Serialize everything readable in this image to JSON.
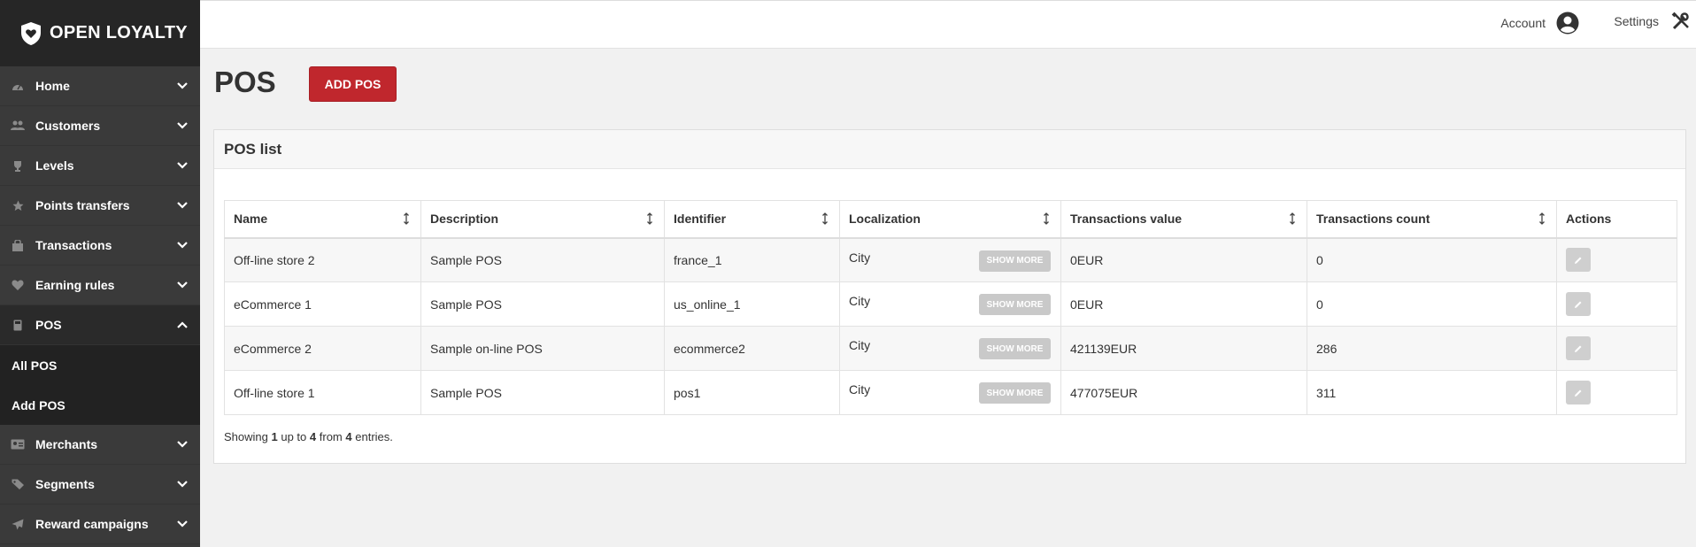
{
  "brand": {
    "name": "OPEN LOYALTY"
  },
  "sidebar": {
    "items": [
      {
        "label": "Home",
        "icon": "dashboard-icon"
      },
      {
        "label": "Customers",
        "icon": "users-icon"
      },
      {
        "label": "Levels",
        "icon": "trophy-icon"
      },
      {
        "label": "Points transfers",
        "icon": "star-icon"
      },
      {
        "label": "Transactions",
        "icon": "bag-icon"
      },
      {
        "label": "Earning rules",
        "icon": "heart-icon"
      },
      {
        "label": "POS",
        "icon": "pos-icon"
      },
      {
        "label": "Merchants",
        "icon": "id-card-icon"
      },
      {
        "label": "Segments",
        "icon": "tags-icon"
      },
      {
        "label": "Reward campaigns",
        "icon": "send-icon"
      }
    ],
    "pos_submenu": [
      {
        "label": "All POS"
      },
      {
        "label": "Add POS"
      }
    ]
  },
  "topbar": {
    "account_label": "Account",
    "settings_label": "Settings"
  },
  "page": {
    "title": "POS",
    "add_button": "ADD POS"
  },
  "panel": {
    "title": "POS list"
  },
  "table": {
    "columns": [
      "Name",
      "Description",
      "Identifier",
      "Localization",
      "Transactions value",
      "Transactions count",
      "Actions"
    ],
    "rows": [
      {
        "name": "Off-line store 2",
        "description": "Sample POS",
        "identifier": "france_1",
        "localization": "City",
        "value": "0EUR",
        "count": "0"
      },
      {
        "name": "eCommerce 1",
        "description": "Sample POS",
        "identifier": "us_online_1",
        "localization": "City",
        "value": "0EUR",
        "count": "0"
      },
      {
        "name": "eCommerce 2",
        "description": "Sample on-line POS",
        "identifier": "ecommerce2",
        "localization": "City",
        "value": "421139EUR",
        "count": "286"
      },
      {
        "name": "Off-line store 1",
        "description": "Sample POS",
        "identifier": "pos1",
        "localization": "City",
        "value": "477075EUR",
        "count": "311"
      }
    ],
    "show_more_label": "SHOW MORE"
  },
  "summary": {
    "prefix": "Showing",
    "from": "1",
    "mid": "up to",
    "to": "4",
    "mid2": "from",
    "total": "4",
    "suffix": "entries."
  },
  "colors": {
    "accent": "#c0272d",
    "sidebar_bg": "#3a3a3a"
  }
}
